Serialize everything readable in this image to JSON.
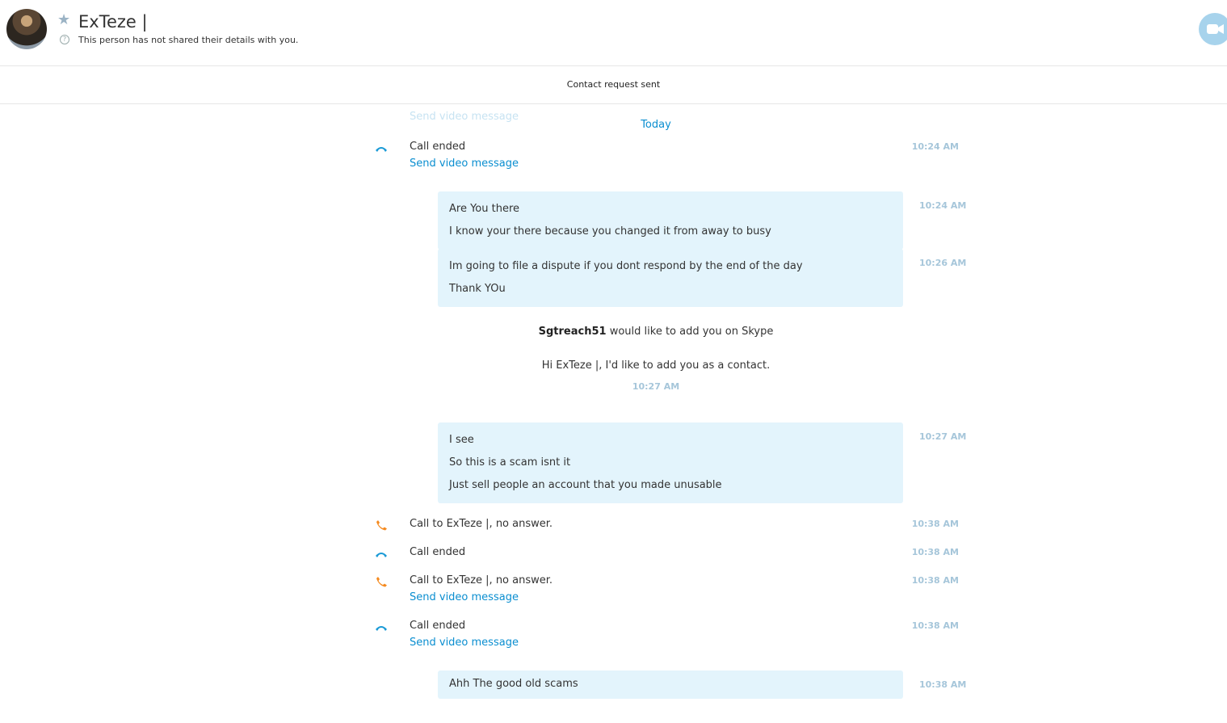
{
  "header": {
    "contact_name": "ExTeze |",
    "details_text": "This person has not shared their details with you.",
    "favorite_icon": "star-icon",
    "video_call_icon": "video-camera-icon"
  },
  "banner": {
    "text": "Contact request sent"
  },
  "day_separator": "Today",
  "faded_link": "Send video message",
  "events": {
    "call_1": {
      "text": "Call ended",
      "link": "Send video message",
      "time": "10:24 AM"
    },
    "msg_1": {
      "lines": [
        "Are You there",
        "I know your there because you changed it from away to busy"
      ],
      "time": "10:24 AM"
    },
    "msg_2": {
      "lines": [
        "Im going to file a dispute if you dont respond by the end of the day",
        "Thank YOu"
      ],
      "time": "10:26 AM"
    },
    "add_request": {
      "username": "Sgtreach51",
      "text": " would like to add you on Skype",
      "message": "Hi ExTeze |, I'd like to add you as a contact.",
      "time": "10:27 AM"
    },
    "msg_3": {
      "lines": [
        "I see",
        "So this is a scam isnt it",
        "Just sell people an account that you made unusable"
      ],
      "time": "10:27 AM"
    },
    "call_2": {
      "text": "Call to ExTeze |, no answer.",
      "time": "10:38 AM"
    },
    "call_3": {
      "text": "Call ended",
      "time": "10:38 AM"
    },
    "call_4": {
      "text": "Call to ExTeze |, no answer.",
      "link": "Send video message",
      "time": "10:38 AM"
    },
    "call_5": {
      "text": "Call ended",
      "link": "Send video message",
      "time": "10:38 AM"
    },
    "msg_4": {
      "lines": [
        "Ahh The good old scams"
      ],
      "time": "10:38 AM"
    }
  },
  "colors": {
    "accent": "#0a8ed0",
    "bubble": "#e3f4fc",
    "missed_call": "#f58a1f",
    "timestamp": "#a6c6da"
  }
}
